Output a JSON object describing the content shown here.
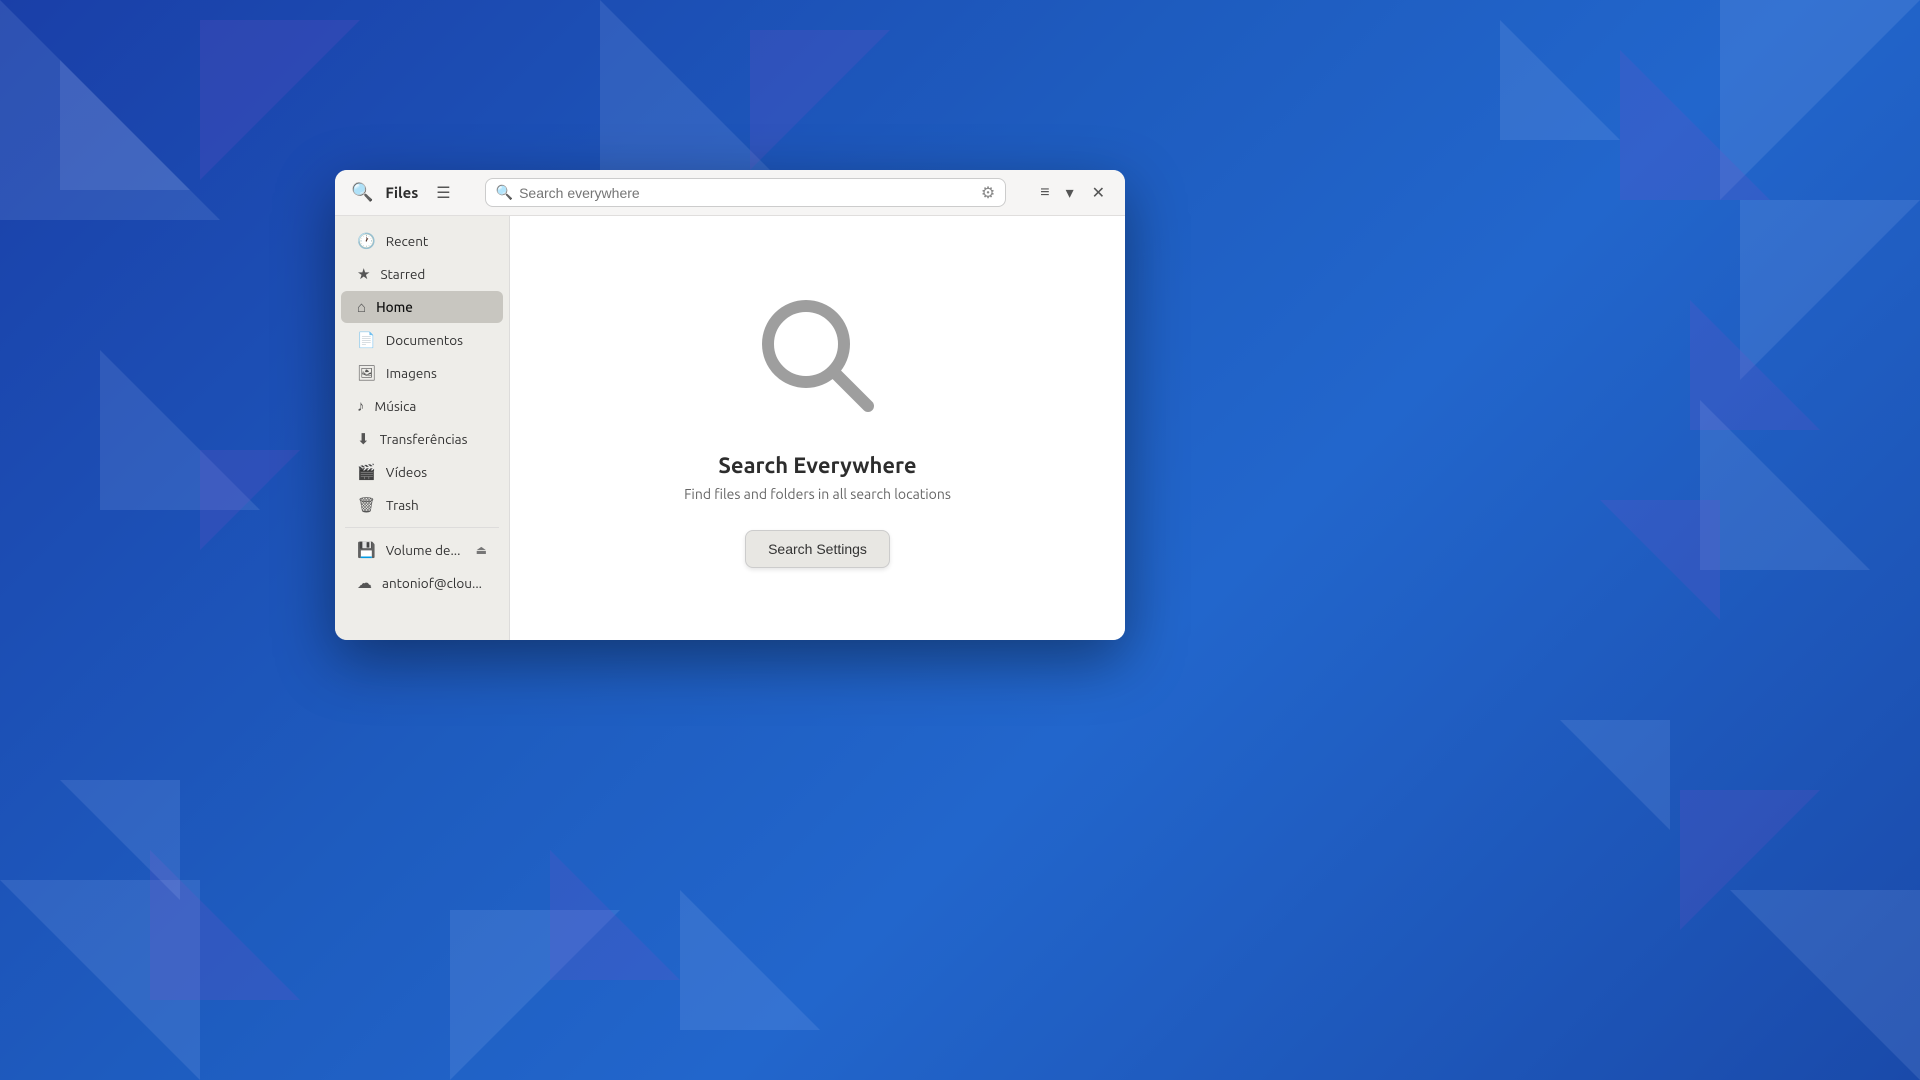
{
  "background": {
    "color_main": "#1a4aaa"
  },
  "window": {
    "title": "Files"
  },
  "header": {
    "title": "Files",
    "search_placeholder": "Search everywhere",
    "menu_label": "☰",
    "list_view_label": "≡",
    "dropdown_label": "▾",
    "close_label": "✕"
  },
  "sidebar": {
    "items": [
      {
        "id": "recent",
        "label": "Recent",
        "icon": "🕐"
      },
      {
        "id": "starred",
        "label": "Starred",
        "icon": "★"
      },
      {
        "id": "home",
        "label": "Home",
        "icon": "⌂",
        "active": true
      },
      {
        "id": "documentos",
        "label": "Documentos",
        "icon": "📄"
      },
      {
        "id": "imagens",
        "label": "Imagens",
        "icon": "🖼"
      },
      {
        "id": "musica",
        "label": "Música",
        "icon": "♪"
      },
      {
        "id": "transferencias",
        "label": "Transferências",
        "icon": "⬇"
      },
      {
        "id": "videos",
        "label": "Vídeos",
        "icon": "🎬"
      },
      {
        "id": "trash",
        "label": "Trash",
        "icon": "🗑"
      }
    ],
    "devices": [
      {
        "id": "volume",
        "label": "Volume de...",
        "has_eject": true,
        "icon": "💾"
      },
      {
        "id": "cloud",
        "label": "antoniof@clou...",
        "icon": "☁"
      }
    ]
  },
  "main": {
    "heading": "Search Everywhere",
    "subheading": "Find files and folders in all search locations",
    "button_label": "Search Settings"
  }
}
